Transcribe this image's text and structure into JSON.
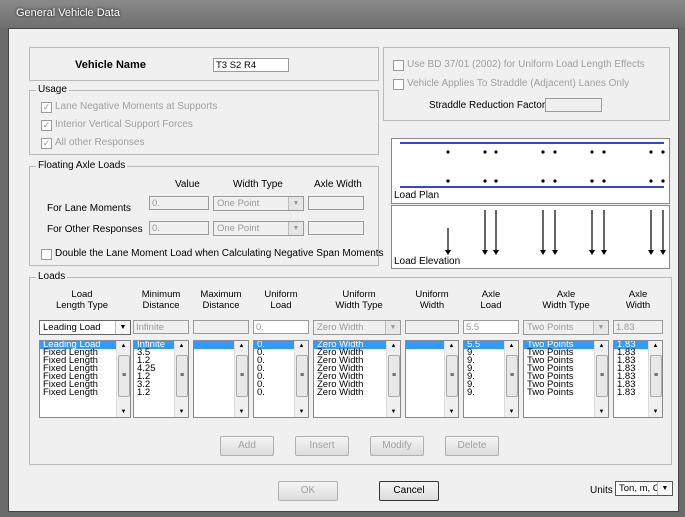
{
  "window": {
    "title": "General Vehicle Data"
  },
  "vehicle": {
    "name_label": "Vehicle Name",
    "name_value": "T3 S2 R4"
  },
  "usage": {
    "legend": "Usage",
    "items": [
      "Lane Negative Moments at Supports",
      "Interior Vertical Support Forces",
      "All other Responses"
    ]
  },
  "options": {
    "bd_label": "Use BD 37/01 (2002) for Uniform Load Length Effects",
    "straddle_label": "Vehicle Applies To Straddle (Adjacent) Lanes Only",
    "straddle_factor_label": "Straddle Reduction Factor",
    "straddle_factor_value": ""
  },
  "floating": {
    "legend": "Floating Axle Loads",
    "col_value": "Value",
    "col_width_type": "Width Type",
    "col_axle_width": "Axle Width",
    "row1_label": "For Lane Moments",
    "row1_value": "0.",
    "row1_width_type": "One Point",
    "row1_axle_width": "",
    "row2_label": "For Other Responses",
    "row2_value": "0.",
    "row2_width_type": "One Point",
    "row2_axle_width": "",
    "double_label": "Double the Lane Moment Load when Calculating Negative Span Moments"
  },
  "plots": {
    "plan_label": "Load Plan",
    "elevation_label": "Load Elevation"
  },
  "loads": {
    "legend": "Loads",
    "headers": {
      "load_type": "Load\nLength Type",
      "min_dist": "Minimum\nDistance",
      "max_dist": "Maximum\nDistance",
      "uniform_load": "Uniform\nLoad",
      "uniform_width_type": "Uniform\nWidth Type",
      "uniform_width": "Uniform\nWidth",
      "axle_load": "Axle\nLoad",
      "axle_width_type": "Axle\nWidth Type",
      "axle_width": "Axle\nWidth"
    },
    "edit": {
      "load_type": "Leading Load",
      "min_dist": "Infinite",
      "max_dist": "",
      "uniform_load": "0.",
      "uniform_width_type": "Zero Width",
      "uniform_width": "",
      "axle_load": "5.5",
      "axle_width_type": "Two Points",
      "axle_width": "1.83"
    },
    "lists": {
      "load_type": [
        "Leading Load",
        "Fixed Length",
        "Fixed Length",
        "Fixed Length",
        "Fixed Length",
        "Fixed Length",
        "Fixed Length"
      ],
      "min_dist": [
        "Infinite",
        "3.5",
        "1.2",
        "4.25",
        "1.2",
        "3.2",
        "1.2"
      ],
      "max_dist": [
        "",
        "",
        "",
        "",
        "",
        "",
        ""
      ],
      "uniform_load": [
        "0.",
        "0.",
        "0.",
        "0.",
        "0.",
        "0.",
        "0."
      ],
      "uniform_width_type": [
        "Zero Width",
        "Zero Width",
        "Zero Width",
        "Zero Width",
        "Zero Width",
        "Zero Width",
        "Zero Width"
      ],
      "uniform_width": [
        "",
        "",
        "",
        "",
        "",
        "",
        ""
      ],
      "axle_load": [
        "5.5",
        "9.",
        "9.",
        "9.",
        "9.",
        "9.",
        "9."
      ],
      "axle_width_type": [
        "Two Points",
        "Two Points",
        "Two Points",
        "Two Points",
        "Two Points",
        "Two Points",
        "Two Points"
      ],
      "axle_width": [
        "1.83",
        "1.83",
        "1.83",
        "1.83",
        "1.83",
        "1.83",
        "1.83"
      ]
    },
    "buttons": {
      "add": "Add",
      "insert": "Insert",
      "modify": "Modify",
      "delete": "Delete"
    }
  },
  "footer": {
    "ok": "OK",
    "cancel": "Cancel",
    "units_label": "Units",
    "units_value": "Ton, m, C"
  },
  "colors": {
    "selection": "#3399ff",
    "plan_line": "#0000cc"
  }
}
